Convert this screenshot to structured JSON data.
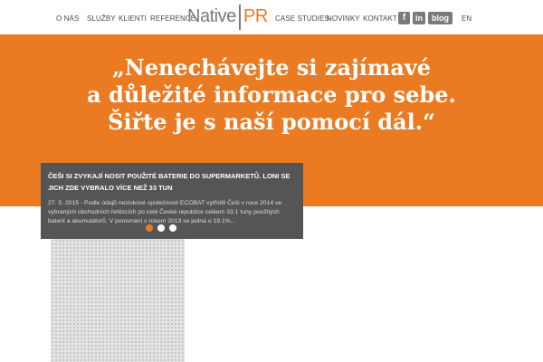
{
  "nav": {
    "left": [
      "O NÁS",
      "SLUŽBY",
      "KLIENTI",
      "REFERENCE"
    ],
    "right": [
      "CASE STUDIES",
      "NOVINKY",
      "KONTAKT"
    ]
  },
  "logo": {
    "part1": "Native",
    "part2": "PR"
  },
  "social": {
    "facebook": "f",
    "linkedin": "in",
    "blog": "blog"
  },
  "lang": "EN",
  "hero": {
    "lines": [
      "„Nenechávejte si zajímavé",
      "a důležité informace pro sebe.",
      "Šiřte je s naší pomocí dál.“"
    ]
  },
  "news": {
    "title": "ČEŠI SI ZVYKAJÍ NOSIT POUŽITÉ BATERIE DO SUPERMARKETŮ. LONI SE JICH ZDE VYBRALO VÍCE NEŽ 33 TUN",
    "body": "27. 5. 2015 - Podle údajů neziskové společnosti ECOBAT vytřídili Češi v roce 2014 ve vybraných obchodních řetězcích po celé České republice celkem 33.1 tuny použitých baterií a akumulátorů. V porovnání s rokem 2013 se jedná o 19.1%..."
  },
  "slider": {
    "count": 3,
    "active": 1
  },
  "colors": {
    "accent": "#ea7b22",
    "card": "#555555",
    "logo_gray": "#7a7a7a"
  }
}
